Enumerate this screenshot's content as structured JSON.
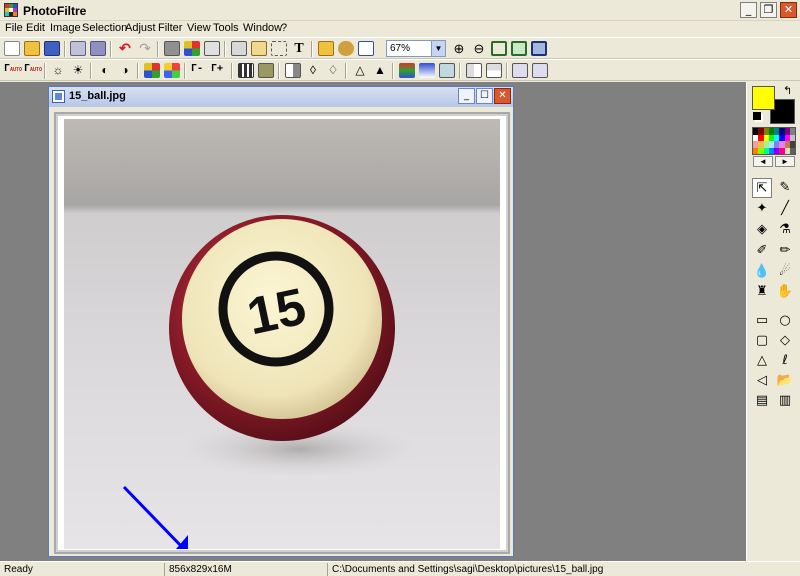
{
  "app": {
    "title": "PhotoFiltre"
  },
  "window_buttons": [
    "_",
    "❐",
    "✕"
  ],
  "menu": [
    "File",
    "Edit",
    "Image",
    "Selection",
    "Adjust",
    "Filter",
    "View",
    "Tools",
    "Window",
    "?"
  ],
  "toolbar": {
    "zoom_value": "67%",
    "text_tool_glyph": "T",
    "gamma_minus": "Γ-",
    "gamma_plus": "Γ+",
    "auto_label": "AUTO"
  },
  "document": {
    "title": "15_ball.jpg",
    "buttons": [
      "_",
      "☐",
      "✕"
    ],
    "ball_number": "15"
  },
  "colors": {
    "foreground": "#ffff00",
    "background": "#000000",
    "arrow": "#0000ff"
  },
  "palette_nav": {
    "prev": "◄",
    "next": "►"
  },
  "tools": [
    {
      "name": "pointer-tool",
      "glyph": "⇱"
    },
    {
      "name": "eyedropper-tool",
      "glyph": "✎"
    },
    {
      "name": "magic-wand-tool",
      "glyph": "✦"
    },
    {
      "name": "line-tool",
      "glyph": "╱"
    },
    {
      "name": "fill-tool",
      "glyph": "◈"
    },
    {
      "name": "spray-tool",
      "glyph": "⚗"
    },
    {
      "name": "brush-tool",
      "glyph": "✐"
    },
    {
      "name": "pencil-tool",
      "glyph": "✏"
    },
    {
      "name": "blur-tool",
      "glyph": "💧"
    },
    {
      "name": "smudge-tool",
      "glyph": "☄"
    },
    {
      "name": "clone-stamp-tool",
      "glyph": "♜"
    },
    {
      "name": "hand-tool",
      "glyph": "✋"
    },
    {
      "name": "rectangle-tool",
      "glyph": "▭"
    },
    {
      "name": "ellipse-tool",
      "glyph": "○"
    },
    {
      "name": "rounded-rect-tool",
      "glyph": "▢"
    },
    {
      "name": "diamond-tool",
      "glyph": "◇"
    },
    {
      "name": "triangle-tool",
      "glyph": "△"
    },
    {
      "name": "lasso-tool",
      "glyph": "ℓ"
    },
    {
      "name": "polygon-tool",
      "glyph": "◁"
    },
    {
      "name": "open-shape-tool",
      "glyph": "📂"
    },
    {
      "name": "selection-a-tool",
      "glyph": "▤"
    },
    {
      "name": "selection-b-tool",
      "glyph": "▥"
    }
  ],
  "status": {
    "state": "Ready",
    "dimensions": "856x829x16M",
    "path": "C:\\Documents and Settings\\sagi\\Desktop\\pictures\\15_ball.jpg"
  }
}
